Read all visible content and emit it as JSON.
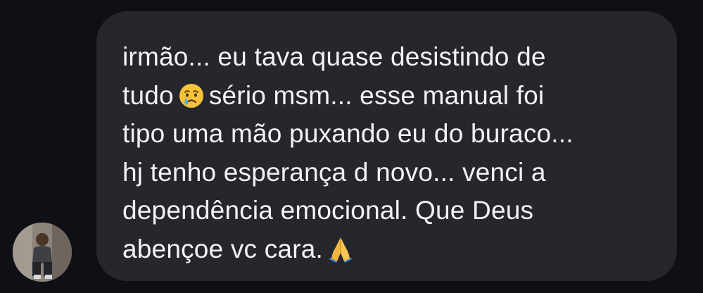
{
  "conversation": {
    "message": {
      "lines": [
        {
          "before": "irmão... eu tava quase desistindo de",
          "after": ""
        },
        {
          "before": "tudo",
          "after": "sério msm... esse manual foi"
        },
        {
          "before": "tipo uma mão puxando eu do buraco...",
          "after": ""
        },
        {
          "before": "hj tenho esperança d novo... venci a",
          "after": ""
        },
        {
          "before": "dependência emocional. Que Deus",
          "after": ""
        },
        {
          "before": "abençoe vc cara.",
          "after": ""
        }
      ],
      "emojis": {
        "crying": "crying-face-icon",
        "praying": "folded-hands-icon"
      }
    },
    "sender": {
      "avatar": "profile-photo"
    }
  },
  "colors": {
    "background": "#0e1015",
    "bubble": "#25272d",
    "text": "#f2f3f5"
  }
}
